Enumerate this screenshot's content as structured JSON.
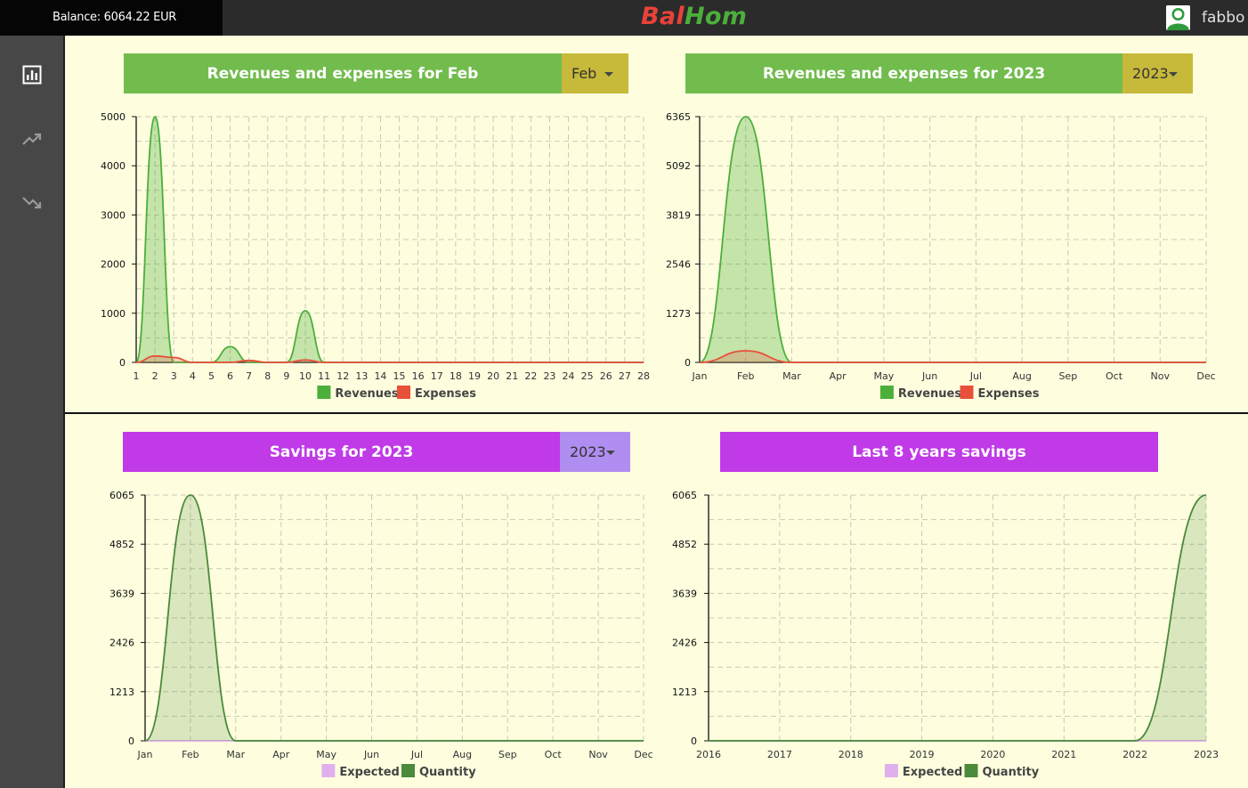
{
  "topbar": {
    "balance": "Balance: 6064.22 EUR",
    "logo_part1": "Bal",
    "logo_part2": "Hom",
    "username": "fabbo"
  },
  "sidebar": {
    "items": [
      {
        "icon": "bar-chart-icon"
      },
      {
        "icon": "trending-up-icon"
      },
      {
        "icon": "trending-down-icon"
      }
    ]
  },
  "panels": {
    "p1": {
      "title": "Revenues and expenses for Feb",
      "select": "Feb"
    },
    "p2": {
      "title": "Revenues and expenses for 2023",
      "select": "2023"
    },
    "p3": {
      "title": "Savings for 2023",
      "select": "2023"
    },
    "p4": {
      "title": "Last 8 years savings"
    }
  },
  "colors": {
    "revenues": "#4caf3c",
    "expenses": "#e8503a",
    "expected": "#e0b0ec",
    "quantity": "#4a8a3a"
  },
  "chart_data": [
    {
      "type": "area",
      "categories": [
        "1",
        "2",
        "3",
        "4",
        "5",
        "6",
        "7",
        "8",
        "9",
        "10",
        "11",
        "12",
        "13",
        "14",
        "15",
        "16",
        "17",
        "18",
        "19",
        "20",
        "21",
        "22",
        "23",
        "24",
        "25",
        "26",
        "27",
        "28"
      ],
      "yticks": [
        "0",
        "1000",
        "2000",
        "3000",
        "4000",
        "5000"
      ],
      "ylim": [
        0,
        5000
      ],
      "series": [
        {
          "name": "Revenues",
          "values": [
            0,
            5000,
            0,
            0,
            0,
            320,
            0,
            0,
            0,
            1050,
            0,
            0,
            0,
            0,
            0,
            0,
            0,
            0,
            0,
            0,
            0,
            0,
            0,
            0,
            0,
            0,
            0,
            0
          ]
        },
        {
          "name": "Expenses",
          "values": [
            0,
            130,
            100,
            0,
            0,
            0,
            40,
            0,
            0,
            50,
            0,
            0,
            0,
            0,
            0,
            0,
            0,
            0,
            0,
            0,
            0,
            0,
            0,
            0,
            0,
            0,
            0,
            0
          ]
        }
      ]
    },
    {
      "type": "area",
      "categories": [
        "Jan",
        "Feb",
        "Mar",
        "Apr",
        "May",
        "Jun",
        "Jul",
        "Aug",
        "Sep",
        "Oct",
        "Nov",
        "Dec"
      ],
      "yticks": [
        "0",
        "1273",
        "2546",
        "3819",
        "5092",
        "6365"
      ],
      "ylim": [
        0,
        6365
      ],
      "series": [
        {
          "name": "Revenues",
          "values": [
            0,
            6365,
            0,
            0,
            0,
            0,
            0,
            0,
            0,
            0,
            0,
            0
          ]
        },
        {
          "name": "Expenses",
          "values": [
            0,
            300,
            0,
            0,
            0,
            0,
            0,
            0,
            0,
            0,
            0,
            0
          ]
        }
      ]
    },
    {
      "type": "area",
      "categories": [
        "Jan",
        "Feb",
        "Mar",
        "Apr",
        "May",
        "Jun",
        "Jul",
        "Aug",
        "Sep",
        "Oct",
        "Nov",
        "Dec"
      ],
      "yticks": [
        "0",
        "1213",
        "2426",
        "3639",
        "4852",
        "6065"
      ],
      "ylim": [
        0,
        6065
      ],
      "series": [
        {
          "name": "Expected",
          "values": [
            0,
            0,
            0,
            0,
            0,
            0,
            0,
            0,
            0,
            0,
            0,
            0
          ]
        },
        {
          "name": "Quantity",
          "values": [
            0,
            6065,
            0,
            0,
            0,
            0,
            0,
            0,
            0,
            0,
            0,
            0
          ]
        }
      ]
    },
    {
      "type": "area",
      "categories": [
        "2016",
        "2017",
        "2018",
        "2019",
        "2020",
        "2021",
        "2022",
        "2023"
      ],
      "yticks": [
        "0",
        "1213",
        "2426",
        "3639",
        "4852",
        "6065"
      ],
      "ylim": [
        0,
        6065
      ],
      "series": [
        {
          "name": "Expected",
          "values": [
            0,
            0,
            0,
            0,
            0,
            0,
            0,
            0
          ]
        },
        {
          "name": "Quantity",
          "values": [
            0,
            0,
            0,
            0,
            0,
            0,
            0,
            6065
          ]
        }
      ]
    }
  ]
}
